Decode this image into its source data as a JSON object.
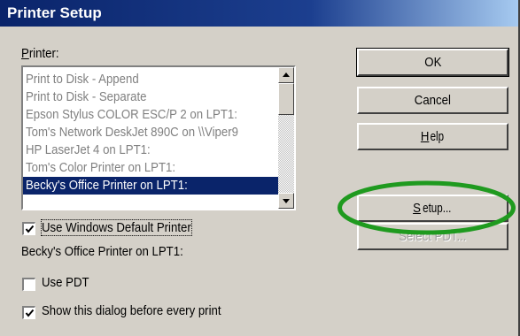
{
  "window": {
    "title": "Printer Setup"
  },
  "printer": {
    "label": "Printer:",
    "items": [
      "Print to Disk - Append",
      "Print to Disk - Separate",
      "Epson Stylus COLOR ESC/P 2 on LPT1:",
      "Tom's Network DeskJet 890C on \\\\Viper9",
      "HP LaserJet 4 on LPT1:",
      "Tom's Color Printer on LPT1:",
      "Becky's Office Printer on LPT1:"
    ],
    "selected_index": 6
  },
  "options": {
    "use_windows_default": {
      "label": "Use Windows Default Printer",
      "checked": true
    },
    "current_printer": "Becky's Office Printer on LPT1:",
    "use_pdt": {
      "label": "Use PDT",
      "checked": false
    },
    "show_dialog": {
      "label": "Show this dialog before every print",
      "checked": true
    }
  },
  "buttons": {
    "ok": "OK",
    "cancel": "Cancel",
    "help": "Help",
    "setup": "Setup...",
    "select_pdt": "Select PDT..."
  },
  "annotation": {
    "color": "#1f9a1f"
  }
}
